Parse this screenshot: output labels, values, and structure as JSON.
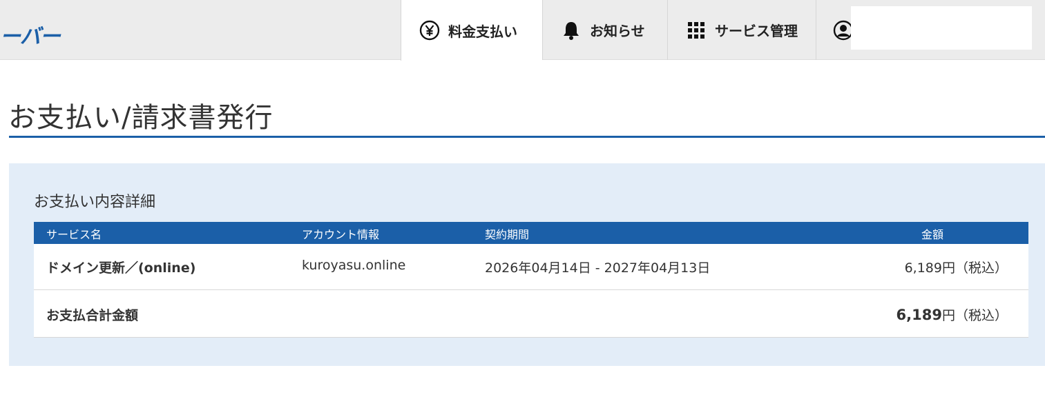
{
  "header": {
    "logo_text": "ーバー",
    "nav": [
      {
        "label": "料金支払い",
        "icon": "yen-icon",
        "active": true
      },
      {
        "label": "お知らせ",
        "icon": "bell-icon",
        "active": false
      },
      {
        "label": "サービス管理",
        "icon": "grid-icon",
        "active": false
      },
      {
        "label": "",
        "icon": "user-icon",
        "active": false
      }
    ]
  },
  "page": {
    "title": "お支払い/請求書発行"
  },
  "panel": {
    "heading": "お支払い内容詳細",
    "columns": [
      "サービス名",
      "アカウント情報",
      "契約期間",
      "金額"
    ],
    "rows": [
      {
        "service": "ドメイン更新／(online)",
        "account": "kuroyasu.online",
        "period": "2026年04月14日 - 2027年04月13日",
        "amount": "6,189円（税込）"
      }
    ],
    "total": {
      "label": "お支払合計金額",
      "amount_number": "6,189",
      "amount_suffix": "円（税込）"
    }
  },
  "colors": {
    "accent": "#1b5fa8",
    "topbar_bg": "#ececec",
    "panel_bg": "#e3edf8"
  }
}
